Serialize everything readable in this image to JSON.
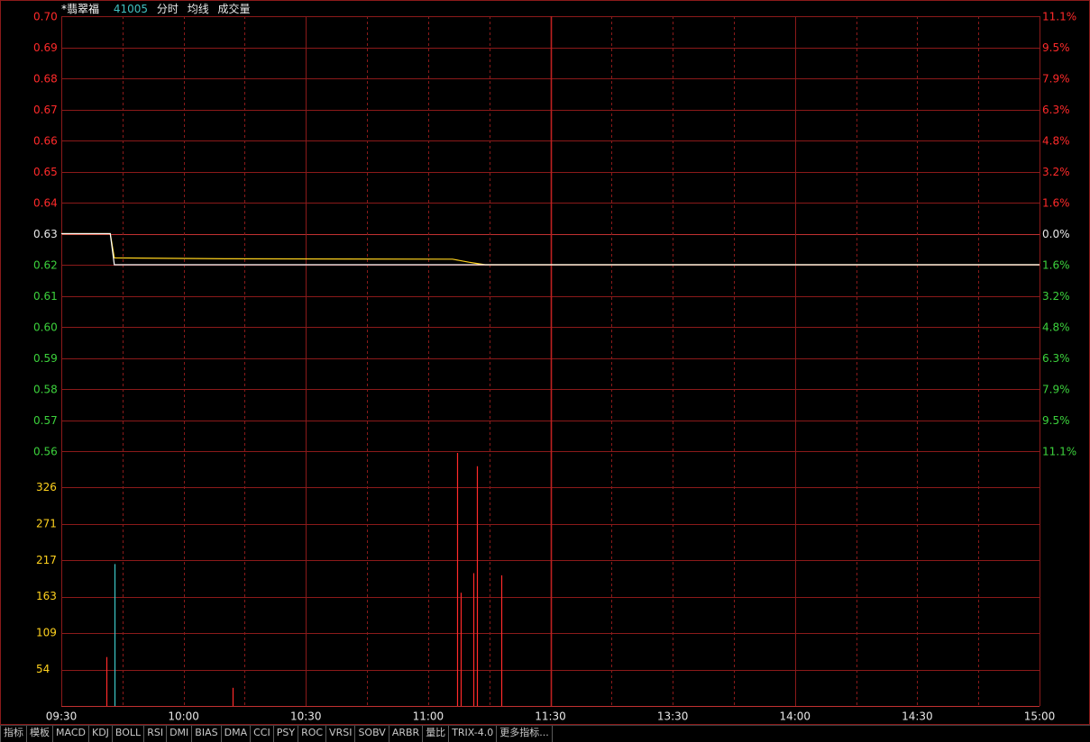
{
  "header": {
    "stock_name": "*翡翠福",
    "stock_code": "41005",
    "indicators": [
      "分时",
      "均线",
      "成交量"
    ]
  },
  "colors": {
    "grid": "#8b1a1a",
    "axis_up": "#ff2a2a",
    "axis_down": "#3cd23c",
    "axis_flat": "#e8e8e8",
    "volume_axis": "#ffd21e",
    "price_line": "#ffffff",
    "avg_line": "#ffd21e",
    "vol_up": "#ff2a2a",
    "vol_down": "#3cc8c8",
    "time_label": "#e8e8e8"
  },
  "chart_data": [
    {
      "type": "line",
      "name": "intraday-price",
      "prev_close": 0.63,
      "ylim": [
        0.56,
        0.7
      ],
      "price_ticks": [
        "0.70",
        "0.69",
        "0.68",
        "0.67",
        "0.66",
        "0.65",
        "0.64",
        "0.63",
        "0.62",
        "0.61",
        "0.60",
        "0.59",
        "0.58",
        "0.57",
        "0.56"
      ],
      "percent_ticks": [
        "11.1%",
        "9.5%",
        "7.9%",
        "6.3%",
        "4.8%",
        "3.2%",
        "1.6%",
        "0.0%",
        "1.6%",
        "3.2%",
        "4.8%",
        "6.3%",
        "7.9%",
        "9.5%",
        "11.1%"
      ],
      "x_labels": [
        "09:30",
        "10:00",
        "10:30",
        "11:00",
        "11:30",
        "13:30",
        "14:00",
        "14:30",
        "15:00"
      ],
      "price_series": [
        {
          "t": 0,
          "v": 0.63
        },
        {
          "t": 12,
          "v": 0.63
        },
        {
          "t": 13,
          "v": 0.62
        },
        {
          "t": 240,
          "v": 0.62
        }
      ],
      "avg_series": [
        {
          "t": 0,
          "v": 0.63
        },
        {
          "t": 12,
          "v": 0.63
        },
        {
          "t": 13,
          "v": 0.6222
        },
        {
          "t": 40,
          "v": 0.6219
        },
        {
          "t": 96,
          "v": 0.6218
        },
        {
          "t": 100,
          "v": 0.6208
        },
        {
          "t": 102,
          "v": 0.6204
        },
        {
          "t": 104,
          "v": 0.62
        },
        {
          "t": 240,
          "v": 0.62
        }
      ]
    },
    {
      "type": "bar",
      "name": "volume",
      "ylim": [
        0,
        362
      ],
      "ticks": [
        "326",
        "271",
        "217",
        "163",
        "109",
        "54"
      ],
      "tick_values": [
        326,
        271,
        217,
        163,
        109,
        54
      ],
      "bars": [
        {
          "t": 11,
          "v": 70,
          "dir": "up"
        },
        {
          "t": 13,
          "v": 203,
          "dir": "down"
        },
        {
          "t": 42,
          "v": 26,
          "dir": "up"
        },
        {
          "t": 97,
          "v": 362,
          "dir": "up"
        },
        {
          "t": 98,
          "v": 162,
          "dir": "up"
        },
        {
          "t": 101,
          "v": 190,
          "dir": "up"
        },
        {
          "t": 102,
          "v": 343,
          "dir": "up"
        },
        {
          "t": 108,
          "v": 187,
          "dir": "up"
        }
      ]
    }
  ],
  "tabs": [
    "指标",
    "模板",
    "MACD",
    "KDJ",
    "BOLL",
    "RSI",
    "DMI",
    "BIAS",
    "DMA",
    "CCI",
    "PSY",
    "ROC",
    "VRSI",
    "SOBV",
    "ARBR",
    "量比",
    "TRIX-4.0",
    "更多指标..."
  ]
}
